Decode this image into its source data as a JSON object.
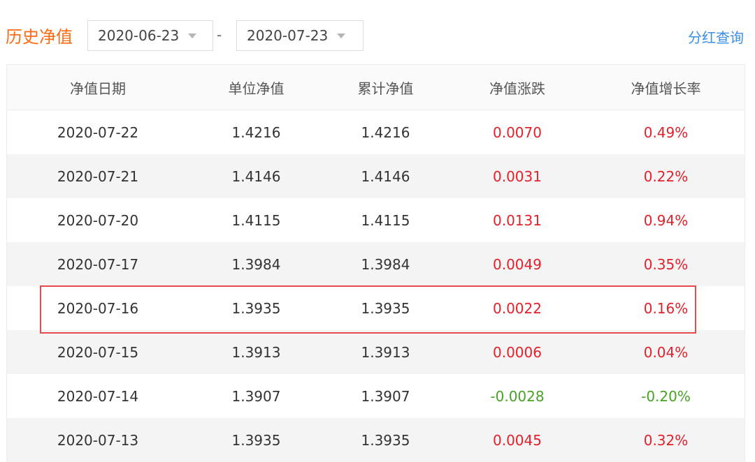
{
  "header": {
    "title": "历史净值",
    "start_date": "2020-06-23",
    "separator": "-",
    "end_date": "2020-07-23",
    "dividend_link": "分红查询"
  },
  "table": {
    "columns": [
      "净值日期",
      "单位净值",
      "累计净值",
      "净值涨跌",
      "净值增长率"
    ],
    "rows": [
      {
        "date": "2020-07-22",
        "unit": "1.4216",
        "accum": "1.4216",
        "change": "0.0070",
        "rate": "0.49%",
        "trend": "up"
      },
      {
        "date": "2020-07-21",
        "unit": "1.4146",
        "accum": "1.4146",
        "change": "0.0031",
        "rate": "0.22%",
        "trend": "up"
      },
      {
        "date": "2020-07-20",
        "unit": "1.4115",
        "accum": "1.4115",
        "change": "0.0131",
        "rate": "0.94%",
        "trend": "up"
      },
      {
        "date": "2020-07-17",
        "unit": "1.3984",
        "accum": "1.3984",
        "change": "0.0049",
        "rate": "0.35%",
        "trend": "up"
      },
      {
        "date": "2020-07-16",
        "unit": "1.3935",
        "accum": "1.3935",
        "change": "0.0022",
        "rate": "0.16%",
        "trend": "up"
      },
      {
        "date": "2020-07-15",
        "unit": "1.3913",
        "accum": "1.3913",
        "change": "0.0006",
        "rate": "0.04%",
        "trend": "up"
      },
      {
        "date": "2020-07-14",
        "unit": "1.3907",
        "accum": "1.3907",
        "change": "-0.0028",
        "rate": "-0.20%",
        "trend": "down"
      },
      {
        "date": "2020-07-13",
        "unit": "1.3935",
        "accum": "1.3935",
        "change": "0.0045",
        "rate": "0.32%",
        "trend": "up"
      }
    ]
  },
  "colors": {
    "accent": "#ff6a13",
    "link": "#3a8ee6",
    "up": "#e4202b",
    "down": "#46a324",
    "highlight_border": "#e64a4a"
  },
  "icons": {
    "date_dropdown": "caret-down-icon"
  }
}
